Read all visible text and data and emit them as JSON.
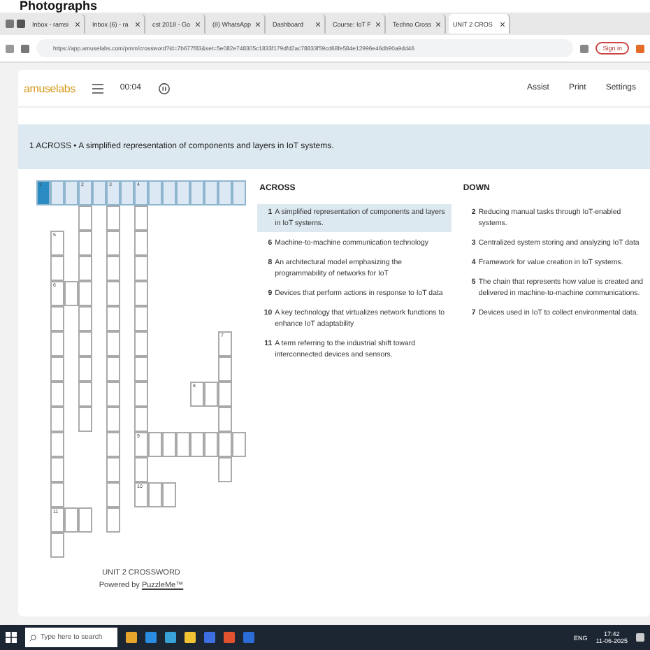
{
  "overlay_heading": "Photographs",
  "browser": {
    "tabs": [
      {
        "label": "Inbox - ramsi",
        "selected": false
      },
      {
        "label": "Inbox (6) - ra",
        "selected": false
      },
      {
        "label": "cst 2018 - Go",
        "selected": false
      },
      {
        "label": "(8) WhatsApp",
        "selected": false
      },
      {
        "label": "Dashboard",
        "selected": false
      },
      {
        "label": "Course: IoT F",
        "selected": false
      },
      {
        "label": "Techno Cross",
        "selected": false
      },
      {
        "label": "UNIT 2 CROS",
        "selected": true
      }
    ],
    "url": "https://app.amuselabs.com/pmm/crossword?id=7b677f83&set=5e082e748305c1833f179dfd2ac78833f59cd68fe584e12996e46db90a9dd46",
    "sign_in": "Sign in"
  },
  "app": {
    "logo": "amuselabs",
    "timer": "00:04",
    "menu": [
      "Assist",
      "Print",
      "Settings"
    ]
  },
  "current_clue": "1 ACROSS • A simplified representation of components and layers in IoT systems.",
  "grid": {
    "rows": [
      [
        {
          "kind": "cell",
          "number": "1",
          "selected": true,
          "active": true
        },
        {
          "kind": "cell",
          "selected": true,
          "active": false
        },
        {
          "kind": "cell",
          "selected": true,
          "active": false
        },
        {
          "kind": "cell",
          "number": "2",
          "selected": true,
          "active": false
        },
        {
          "kind": "cell",
          "selected": true,
          "active": false
        },
        {
          "kind": "cell",
          "number": "3",
          "selected": true,
          "active": false
        },
        {
          "kind": "cell",
          "selected": true,
          "active": false
        },
        {
          "kind": "cell",
          "number": "4",
          "selected": true,
          "active": false
        },
        {
          "kind": "cell",
          "selected": true,
          "active": false
        },
        {
          "kind": "cell",
          "selected": true,
          "active": false
        },
        {
          "kind": "cell",
          "selected": true,
          "active": false
        },
        {
          "kind": "cell",
          "selected": true,
          "active": false
        },
        {
          "kind": "cell",
          "selected": true,
          "active": false
        },
        {
          "kind": "cell",
          "selected": true,
          "active": false
        },
        {
          "kind": "cell",
          "selected": true,
          "active": false
        }
      ],
      [
        {
          "kind": "block"
        },
        {
          "kind": "block"
        },
        {
          "kind": "block"
        },
        {
          "kind": "cell",
          "selected": false,
          "active": false
        },
        {
          "kind": "block"
        },
        {
          "kind": "cell",
          "selected": false,
          "active": false
        },
        {
          "kind": "block"
        },
        {
          "kind": "cell",
          "selected": false,
          "active": false
        },
        {
          "kind": "block"
        },
        {
          "kind": "block"
        },
        {
          "kind": "block"
        },
        {
          "kind": "block"
        },
        {
          "kind": "block"
        },
        {
          "kind": "block"
        },
        {
          "kind": "block"
        }
      ],
      [
        {
          "kind": "block"
        },
        {
          "kind": "cell",
          "number": "5",
          "selected": false,
          "active": false
        },
        {
          "kind": "block"
        },
        {
          "kind": "cell",
          "selected": false,
          "active": false
        },
        {
          "kind": "block"
        },
        {
          "kind": "cell",
          "selected": false,
          "active": false
        },
        {
          "kind": "block"
        },
        {
          "kind": "cell",
          "selected": false,
          "active": false
        },
        {
          "kind": "block"
        },
        {
          "kind": "block"
        },
        {
          "kind": "block"
        },
        {
          "kind": "block"
        },
        {
          "kind": "block"
        },
        {
          "kind": "block"
        },
        {
          "kind": "block"
        }
      ],
      [
        {
          "kind": "block"
        },
        {
          "kind": "cell",
          "selected": false,
          "active": false
        },
        {
          "kind": "block"
        },
        {
          "kind": "cell",
          "selected": false,
          "active": false
        },
        {
          "kind": "block"
        },
        {
          "kind": "cell",
          "selected": false,
          "active": false
        },
        {
          "kind": "block"
        },
        {
          "kind": "cell",
          "selected": false,
          "active": false
        },
        {
          "kind": "block"
        },
        {
          "kind": "block"
        },
        {
          "kind": "block"
        },
        {
          "kind": "block"
        },
        {
          "kind": "block"
        },
        {
          "kind": "block"
        },
        {
          "kind": "block"
        }
      ],
      [
        {
          "kind": "block"
        },
        {
          "kind": "cell",
          "number": "6",
          "selected": false,
          "active": false
        },
        {
          "kind": "cell",
          "selected": false,
          "active": false
        },
        {
          "kind": "cell",
          "selected": false,
          "active": false
        },
        {
          "kind": "block"
        },
        {
          "kind": "cell",
          "selected": false,
          "active": false
        },
        {
          "kind": "block"
        },
        {
          "kind": "cell",
          "selected": false,
          "active": false
        },
        {
          "kind": "block"
        },
        {
          "kind": "block"
        },
        {
          "kind": "block"
        },
        {
          "kind": "block"
        },
        {
          "kind": "block"
        },
        {
          "kind": "block"
        },
        {
          "kind": "block"
        }
      ],
      [
        {
          "kind": "block"
        },
        {
          "kind": "cell",
          "selected": false,
          "active": false
        },
        {
          "kind": "block"
        },
        {
          "kind": "cell",
          "selected": false,
          "active": false
        },
        {
          "kind": "block"
        },
        {
          "kind": "cell",
          "selected": false,
          "active": false
        },
        {
          "kind": "block"
        },
        {
          "kind": "cell",
          "selected": false,
          "active": false
        },
        {
          "kind": "block"
        },
        {
          "kind": "block"
        },
        {
          "kind": "block"
        },
        {
          "kind": "block"
        },
        {
          "kind": "block"
        },
        {
          "kind": "block"
        },
        {
          "kind": "block"
        }
      ],
      [
        {
          "kind": "block"
        },
        {
          "kind": "cell",
          "selected": false,
          "active": false
        },
        {
          "kind": "block"
        },
        {
          "kind": "cell",
          "selected": false,
          "active": false
        },
        {
          "kind": "block"
        },
        {
          "kind": "cell",
          "selected": false,
          "active": false
        },
        {
          "kind": "block"
        },
        {
          "kind": "cell",
          "selected": false,
          "active": false
        },
        {
          "kind": "block"
        },
        {
          "kind": "block"
        },
        {
          "kind": "block"
        },
        {
          "kind": "block"
        },
        {
          "kind": "block"
        },
        {
          "kind": "cell",
          "number": "7",
          "selected": false,
          "active": false
        },
        {
          "kind": "block"
        }
      ],
      [
        {
          "kind": "block"
        },
        {
          "kind": "cell",
          "selected": false,
          "active": false
        },
        {
          "kind": "block"
        },
        {
          "kind": "cell",
          "selected": false,
          "active": false
        },
        {
          "kind": "block"
        },
        {
          "kind": "cell",
          "selected": false,
          "active": false
        },
        {
          "kind": "block"
        },
        {
          "kind": "cell",
          "selected": false,
          "active": false
        },
        {
          "kind": "block"
        },
        {
          "kind": "block"
        },
        {
          "kind": "block"
        },
        {
          "kind": "block"
        },
        {
          "kind": "block"
        },
        {
          "kind": "cell",
          "selected": false,
          "active": false
        },
        {
          "kind": "block"
        }
      ],
      [
        {
          "kind": "block"
        },
        {
          "kind": "cell",
          "selected": false,
          "active": false
        },
        {
          "kind": "block"
        },
        {
          "kind": "cell",
          "selected": false,
          "active": false
        },
        {
          "kind": "block"
        },
        {
          "kind": "cell",
          "selected": false,
          "active": false
        },
        {
          "kind": "block"
        },
        {
          "kind": "cell",
          "selected": false,
          "active": false
        },
        {
          "kind": "block"
        },
        {
          "kind": "block"
        },
        {
          "kind": "block"
        },
        {
          "kind": "cell",
          "number": "8",
          "selected": false,
          "active": false
        },
        {
          "kind": "cell",
          "selected": false,
          "active": false
        },
        {
          "kind": "cell",
          "selected": false,
          "active": false
        },
        {
          "kind": "block"
        }
      ],
      [
        {
          "kind": "block"
        },
        {
          "kind": "cell",
          "selected": false,
          "active": false
        },
        {
          "kind": "block"
        },
        {
          "kind": "cell",
          "selected": false,
          "active": false
        },
        {
          "kind": "block"
        },
        {
          "kind": "cell",
          "selected": false,
          "active": false
        },
        {
          "kind": "block"
        },
        {
          "kind": "cell",
          "selected": false,
          "active": false
        },
        {
          "kind": "block"
        },
        {
          "kind": "block"
        },
        {
          "kind": "block"
        },
        {
          "kind": "block"
        },
        {
          "kind": "block"
        },
        {
          "kind": "cell",
          "selected": false,
          "active": false
        },
        {
          "kind": "block"
        }
      ],
      [
        {
          "kind": "block"
        },
        {
          "kind": "cell",
          "selected": false,
          "active": false
        },
        {
          "kind": "block"
        },
        {
          "kind": "block"
        },
        {
          "kind": "block"
        },
        {
          "kind": "cell",
          "selected": false,
          "active": false
        },
        {
          "kind": "block"
        },
        {
          "kind": "cell",
          "number": "9",
          "selected": false,
          "active": false
        },
        {
          "kind": "cell",
          "selected": false,
          "active": false
        },
        {
          "kind": "cell",
          "selected": false,
          "active": false
        },
        {
          "kind": "cell",
          "selected": false,
          "active": false
        },
        {
          "kind": "cell",
          "selected": false,
          "active": false
        },
        {
          "kind": "cell",
          "selected": false,
          "active": false
        },
        {
          "kind": "cell",
          "selected": false,
          "active": false
        },
        {
          "kind": "cell",
          "selected": false,
          "active": false
        }
      ],
      [
        {
          "kind": "block"
        },
        {
          "kind": "cell",
          "selected": false,
          "active": false
        },
        {
          "kind": "block"
        },
        {
          "kind": "block"
        },
        {
          "kind": "block"
        },
        {
          "kind": "cell",
          "selected": false,
          "active": false
        },
        {
          "kind": "block"
        },
        {
          "kind": "cell",
          "selected": false,
          "active": false
        },
        {
          "kind": "block"
        },
        {
          "kind": "block"
        },
        {
          "kind": "block"
        },
        {
          "kind": "block"
        },
        {
          "kind": "block"
        },
        {
          "kind": "cell",
          "selected": false,
          "active": false
        },
        {
          "kind": "block"
        }
      ],
      [
        {
          "kind": "block"
        },
        {
          "kind": "cell",
          "selected": false,
          "active": false
        },
        {
          "kind": "block"
        },
        {
          "kind": "block"
        },
        {
          "kind": "block"
        },
        {
          "kind": "cell",
          "selected": false,
          "active": false
        },
        {
          "kind": "block"
        },
        {
          "kind": "cell",
          "number": "10",
          "selected": false,
          "active": false
        },
        {
          "kind": "cell",
          "selected": false,
          "active": false
        },
        {
          "kind": "cell",
          "selected": false,
          "active": false
        },
        {
          "kind": "block"
        },
        {
          "kind": "block"
        },
        {
          "kind": "block"
        },
        {
          "kind": "block"
        },
        {
          "kind": "block"
        }
      ],
      [
        {
          "kind": "block"
        },
        {
          "kind": "cell",
          "number": "11",
          "selected": false,
          "active": false
        },
        {
          "kind": "cell",
          "selected": false,
          "active": false
        },
        {
          "kind": "cell",
          "selected": false,
          "active": false
        },
        {
          "kind": "block"
        },
        {
          "kind": "cell",
          "selected": false,
          "active": false
        },
        {
          "kind": "block"
        },
        {
          "kind": "block"
        },
        {
          "kind": "block"
        },
        {
          "kind": "block"
        },
        {
          "kind": "block"
        },
        {
          "kind": "block"
        },
        {
          "kind": "block"
        },
        {
          "kind": "block"
        },
        {
          "kind": "block"
        }
      ],
      [
        {
          "kind": "block"
        },
        {
          "kind": "cell",
          "selected": false,
          "active": false
        },
        {
          "kind": "block"
        },
        {
          "kind": "block"
        },
        {
          "kind": "block"
        },
        {
          "kind": "block"
        },
        {
          "kind": "block"
        },
        {
          "kind": "block"
        },
        {
          "kind": "block"
        },
        {
          "kind": "block"
        },
        {
          "kind": "block"
        },
        {
          "kind": "block"
        },
        {
          "kind": "block"
        },
        {
          "kind": "block"
        },
        {
          "kind": "block"
        }
      ]
    ]
  },
  "puzzle_title": "UNIT 2 CROSSWORD",
  "powered_by": "Powered by",
  "powered_link": "PuzzleMe™",
  "across": {
    "title": "ACROSS",
    "clues": [
      {
        "number": "1",
        "text": "A simplified representation of components and layers in IoT systems.",
        "selected": true
      },
      {
        "number": "6",
        "text": "Machine-to-machine communication technology",
        "selected": false
      },
      {
        "number": "8",
        "text": "An architectural model emphasizing the programmability of networks for IoT",
        "selected": false
      },
      {
        "number": "9",
        "text": "Devices that perform actions in response to IoT data",
        "selected": false
      },
      {
        "number": "10",
        "text": "A key technology that virtualizes network functions to enhance IoT adaptability",
        "selected": false
      },
      {
        "number": "11",
        "text": "A term referring to the industrial shift toward interconnected devices and sensors.",
        "selected": false
      }
    ]
  },
  "down": {
    "title": "DOWN",
    "clues": [
      {
        "number": "2",
        "text": "Reducing manual tasks through IoT-enabled systems.",
        "selected": false
      },
      {
        "number": "3",
        "text": "Centralized system storing and analyzing IoT data",
        "selected": false
      },
      {
        "number": "4",
        "text": "Framework for value creation in IoT systems.",
        "selected": false
      },
      {
        "number": "5",
        "text": "The chain that represents how value is created and delivered in machine-to-machine communications.",
        "selected": false
      },
      {
        "number": "7",
        "text": "Devices used in IoT to collect environmental data.",
        "selected": false
      }
    ]
  },
  "taskbar": {
    "search_placeholder": "Type here to search",
    "language": "ENG",
    "time": "17:42",
    "date": "11-06-2025"
  }
}
